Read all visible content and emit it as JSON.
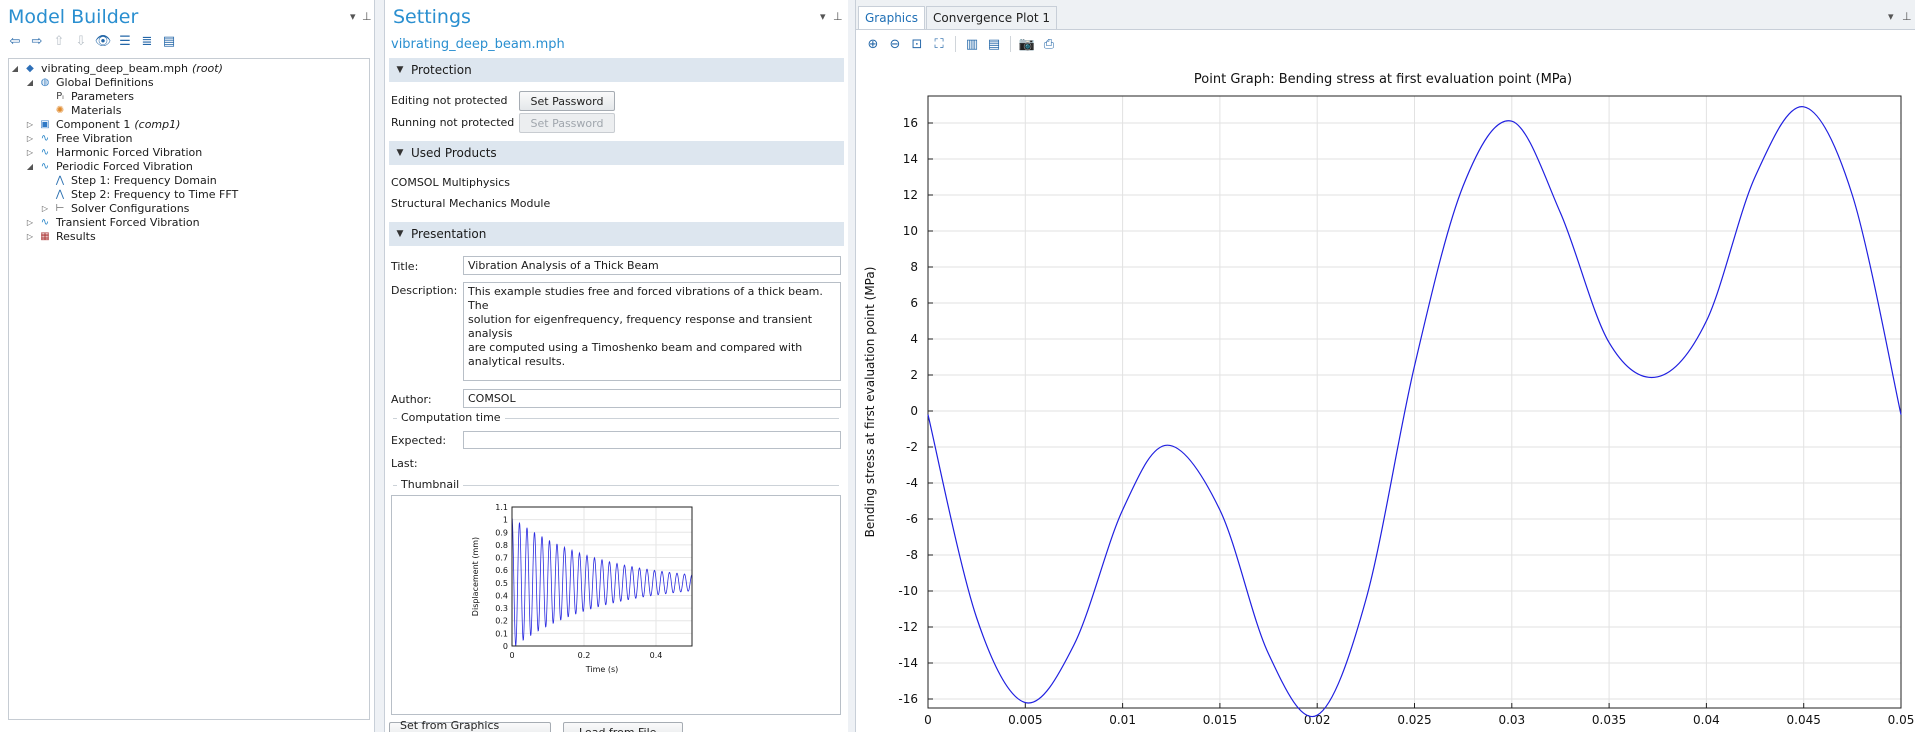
{
  "model_builder": {
    "title": "Model Builder",
    "toolbar_icons": [
      "back-arrow-icon",
      "forward-arrow-icon",
      "move-up-icon",
      "move-down-icon",
      "show-icon",
      "collapse-icon",
      "expand-icon",
      "options-icon"
    ],
    "tree": [
      {
        "label": "vibrating_deep_beam.mph",
        "suffix": "(root)",
        "icon": "model-icon",
        "depth": 0,
        "twisty": "open"
      },
      {
        "label": "Global Definitions",
        "suffix": "",
        "icon": "globe-icon",
        "depth": 1,
        "twisty": "open"
      },
      {
        "label": "Parameters",
        "suffix": "",
        "icon": "parameters-icon",
        "depth": 2,
        "twisty": "none"
      },
      {
        "label": "Materials",
        "suffix": "",
        "icon": "materials-icon",
        "depth": 2,
        "twisty": "none"
      },
      {
        "label": "Component 1",
        "suffix": "(comp1)",
        "icon": "component-icon",
        "depth": 1,
        "twisty": "closed"
      },
      {
        "label": "Free Vibration",
        "suffix": "",
        "icon": "study-icon",
        "depth": 1,
        "twisty": "closed"
      },
      {
        "label": "Harmonic Forced Vibration",
        "suffix": "",
        "icon": "study-icon",
        "depth": 1,
        "twisty": "closed"
      },
      {
        "label": "Periodic Forced Vibration",
        "suffix": "",
        "icon": "study-icon",
        "depth": 1,
        "twisty": "open"
      },
      {
        "label": "Step 1: Frequency Domain",
        "suffix": "",
        "icon": "step-icon",
        "depth": 2,
        "twisty": "none"
      },
      {
        "label": "Step 2: Frequency to Time FFT",
        "suffix": "",
        "icon": "step-icon",
        "depth": 2,
        "twisty": "none"
      },
      {
        "label": "Solver Configurations",
        "suffix": "",
        "icon": "solver-icon",
        "depth": 2,
        "twisty": "closed"
      },
      {
        "label": "Transient Forced Vibration",
        "suffix": "",
        "icon": "study-icon",
        "depth": 1,
        "twisty": "closed"
      },
      {
        "label": "Results",
        "suffix": "",
        "icon": "results-icon",
        "depth": 1,
        "twisty": "closed"
      }
    ]
  },
  "settings": {
    "title": "Settings",
    "subtitle": "vibrating_deep_beam.mph",
    "protection": {
      "header": "Protection",
      "editing_label": "Editing not protected",
      "running_label": "Running not protected",
      "set_password": "Set Password"
    },
    "used_products": {
      "header": "Used Products",
      "items": [
        "COMSOL Multiphysics",
        "Structural Mechanics Module"
      ]
    },
    "presentation": {
      "header": "Presentation",
      "title_label": "Title:",
      "title_value": "Vibration Analysis of a Thick Beam",
      "description_label": "Description:",
      "description_lines": [
        "This example studies free and forced vibrations of a thick beam. The",
        "solution for eigenfrequency, frequency response and transient analysis",
        "are computed using a Timoshenko beam and compared with",
        "analytical results."
      ],
      "author_label": "Author:",
      "author_value": "COMSOL",
      "computation_time": "Computation time",
      "expected_label": "Expected:",
      "expected_value": "",
      "last_label": "Last:",
      "thumbnail_label": "Thumbnail",
      "set_from_graphics": "Set from Graphics Window",
      "load_from_file": "Load from File..."
    },
    "thumbnail_chart": {
      "ylabel": "Displacement (mm)",
      "xlabel": "Time (s)",
      "yticks": [
        "0",
        "0.1",
        "0.2",
        "0.3",
        "0.4",
        "0.5",
        "0.6",
        "0.7",
        "0.8",
        "0.9",
        "1",
        "1.1"
      ],
      "xticks": [
        "0",
        "0.2",
        "0.4"
      ]
    }
  },
  "graphics": {
    "tabs": [
      "Graphics",
      "Convergence Plot 1"
    ],
    "toolbar_icons": [
      "zoom-in-icon",
      "zoom-out-icon",
      "zoom-box-icon",
      "zoom-extents-icon",
      "grid-icon",
      "table-icon",
      "camera-icon",
      "print-icon"
    ],
    "line_color": "#2020e0"
  },
  "chart_data": {
    "type": "line",
    "title": "Point Graph: Bending stress at first evaluation point (MPa)",
    "ylabel": "Bending stress at first evaluation point (MPa)",
    "xlabel": "",
    "xlim": [
      0,
      0.05
    ],
    "ylim": [
      -16.5,
      17.5
    ],
    "xticks": [
      "0",
      "0.005",
      "0.01",
      "0.015",
      "0.02",
      "0.025",
      "0.03",
      "0.035",
      "0.04",
      "0.045",
      "0.05"
    ],
    "yticks": [
      "-16",
      "-14",
      "-12",
      "-10",
      "-8",
      "-6",
      "-4",
      "-2",
      "0",
      "2",
      "4",
      "6",
      "8",
      "10",
      "12",
      "14",
      "16"
    ],
    "grid": true,
    "series": [
      {
        "name": "",
        "x": [
          0,
          0.0025,
          0.005,
          0.0075,
          0.01,
          0.0123,
          0.015,
          0.0175,
          0.02,
          0.0225,
          0.025,
          0.0275,
          0.03,
          0.0325,
          0.035,
          0.0375,
          0.04,
          0.0425,
          0.045,
          0.0475,
          0.05
        ],
        "y": [
          -0.2,
          -11.5,
          -16.2,
          -13.0,
          -5.5,
          -1.9,
          -5.5,
          -13.5,
          -16.9,
          -10.5,
          2.5,
          12.5,
          16.1,
          11.0,
          3.8,
          1.9,
          5.0,
          13.0,
          16.9,
          12.0,
          -0.2
        ]
      }
    ]
  }
}
